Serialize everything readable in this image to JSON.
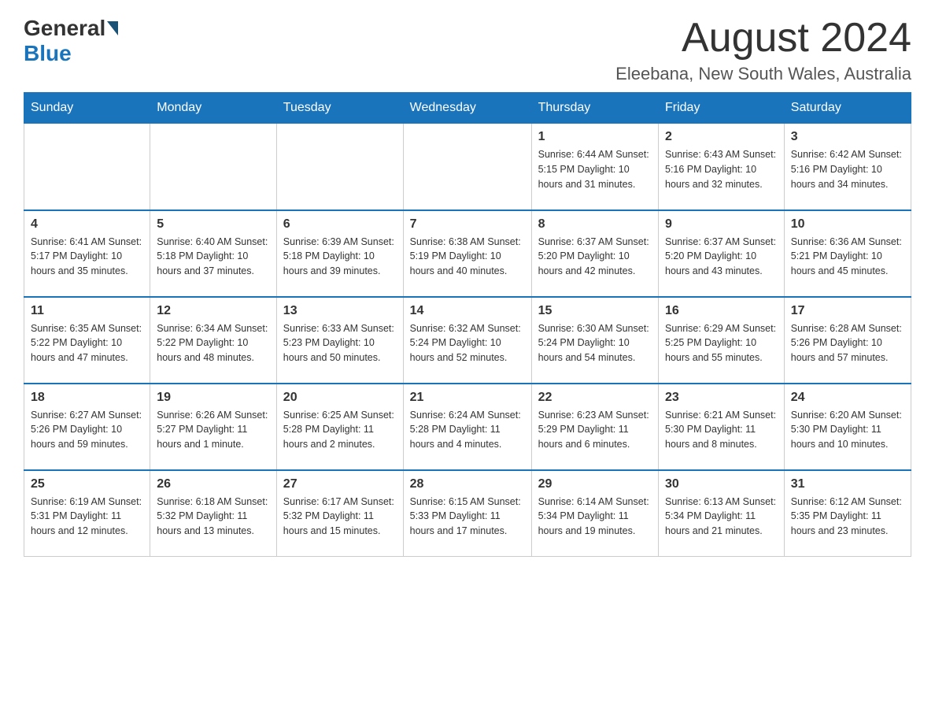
{
  "header": {
    "logo_general": "General",
    "logo_blue": "Blue",
    "month_title": "August 2024",
    "location": "Eleebana, New South Wales, Australia"
  },
  "days_of_week": [
    "Sunday",
    "Monday",
    "Tuesday",
    "Wednesday",
    "Thursday",
    "Friday",
    "Saturday"
  ],
  "weeks": [
    [
      {
        "day": "",
        "info": ""
      },
      {
        "day": "",
        "info": ""
      },
      {
        "day": "",
        "info": ""
      },
      {
        "day": "",
        "info": ""
      },
      {
        "day": "1",
        "info": "Sunrise: 6:44 AM\nSunset: 5:15 PM\nDaylight: 10 hours and 31 minutes."
      },
      {
        "day": "2",
        "info": "Sunrise: 6:43 AM\nSunset: 5:16 PM\nDaylight: 10 hours and 32 minutes."
      },
      {
        "day": "3",
        "info": "Sunrise: 6:42 AM\nSunset: 5:16 PM\nDaylight: 10 hours and 34 minutes."
      }
    ],
    [
      {
        "day": "4",
        "info": "Sunrise: 6:41 AM\nSunset: 5:17 PM\nDaylight: 10 hours and 35 minutes."
      },
      {
        "day": "5",
        "info": "Sunrise: 6:40 AM\nSunset: 5:18 PM\nDaylight: 10 hours and 37 minutes."
      },
      {
        "day": "6",
        "info": "Sunrise: 6:39 AM\nSunset: 5:18 PM\nDaylight: 10 hours and 39 minutes."
      },
      {
        "day": "7",
        "info": "Sunrise: 6:38 AM\nSunset: 5:19 PM\nDaylight: 10 hours and 40 minutes."
      },
      {
        "day": "8",
        "info": "Sunrise: 6:37 AM\nSunset: 5:20 PM\nDaylight: 10 hours and 42 minutes."
      },
      {
        "day": "9",
        "info": "Sunrise: 6:37 AM\nSunset: 5:20 PM\nDaylight: 10 hours and 43 minutes."
      },
      {
        "day": "10",
        "info": "Sunrise: 6:36 AM\nSunset: 5:21 PM\nDaylight: 10 hours and 45 minutes."
      }
    ],
    [
      {
        "day": "11",
        "info": "Sunrise: 6:35 AM\nSunset: 5:22 PM\nDaylight: 10 hours and 47 minutes."
      },
      {
        "day": "12",
        "info": "Sunrise: 6:34 AM\nSunset: 5:22 PM\nDaylight: 10 hours and 48 minutes."
      },
      {
        "day": "13",
        "info": "Sunrise: 6:33 AM\nSunset: 5:23 PM\nDaylight: 10 hours and 50 minutes."
      },
      {
        "day": "14",
        "info": "Sunrise: 6:32 AM\nSunset: 5:24 PM\nDaylight: 10 hours and 52 minutes."
      },
      {
        "day": "15",
        "info": "Sunrise: 6:30 AM\nSunset: 5:24 PM\nDaylight: 10 hours and 54 minutes."
      },
      {
        "day": "16",
        "info": "Sunrise: 6:29 AM\nSunset: 5:25 PM\nDaylight: 10 hours and 55 minutes."
      },
      {
        "day": "17",
        "info": "Sunrise: 6:28 AM\nSunset: 5:26 PM\nDaylight: 10 hours and 57 minutes."
      }
    ],
    [
      {
        "day": "18",
        "info": "Sunrise: 6:27 AM\nSunset: 5:26 PM\nDaylight: 10 hours and 59 minutes."
      },
      {
        "day": "19",
        "info": "Sunrise: 6:26 AM\nSunset: 5:27 PM\nDaylight: 11 hours and 1 minute."
      },
      {
        "day": "20",
        "info": "Sunrise: 6:25 AM\nSunset: 5:28 PM\nDaylight: 11 hours and 2 minutes."
      },
      {
        "day": "21",
        "info": "Sunrise: 6:24 AM\nSunset: 5:28 PM\nDaylight: 11 hours and 4 minutes."
      },
      {
        "day": "22",
        "info": "Sunrise: 6:23 AM\nSunset: 5:29 PM\nDaylight: 11 hours and 6 minutes."
      },
      {
        "day": "23",
        "info": "Sunrise: 6:21 AM\nSunset: 5:30 PM\nDaylight: 11 hours and 8 minutes."
      },
      {
        "day": "24",
        "info": "Sunrise: 6:20 AM\nSunset: 5:30 PM\nDaylight: 11 hours and 10 minutes."
      }
    ],
    [
      {
        "day": "25",
        "info": "Sunrise: 6:19 AM\nSunset: 5:31 PM\nDaylight: 11 hours and 12 minutes."
      },
      {
        "day": "26",
        "info": "Sunrise: 6:18 AM\nSunset: 5:32 PM\nDaylight: 11 hours and 13 minutes."
      },
      {
        "day": "27",
        "info": "Sunrise: 6:17 AM\nSunset: 5:32 PM\nDaylight: 11 hours and 15 minutes."
      },
      {
        "day": "28",
        "info": "Sunrise: 6:15 AM\nSunset: 5:33 PM\nDaylight: 11 hours and 17 minutes."
      },
      {
        "day": "29",
        "info": "Sunrise: 6:14 AM\nSunset: 5:34 PM\nDaylight: 11 hours and 19 minutes."
      },
      {
        "day": "30",
        "info": "Sunrise: 6:13 AM\nSunset: 5:34 PM\nDaylight: 11 hours and 21 minutes."
      },
      {
        "day": "31",
        "info": "Sunrise: 6:12 AM\nSunset: 5:35 PM\nDaylight: 11 hours and 23 minutes."
      }
    ]
  ]
}
